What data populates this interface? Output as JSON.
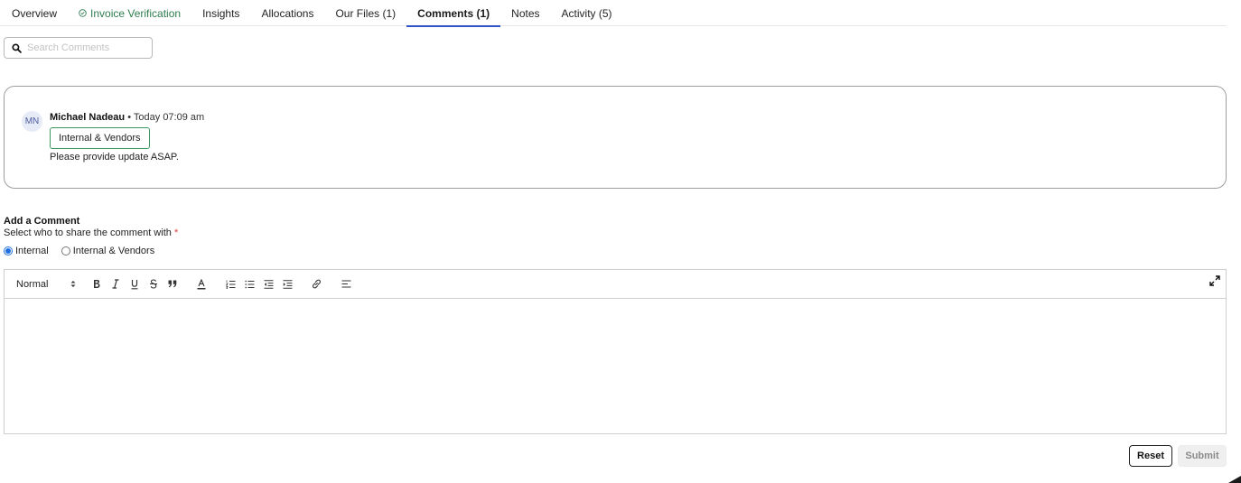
{
  "tabs": [
    {
      "label": "Overview"
    },
    {
      "label": "Invoice Verification",
      "icon": "check-circle-icon"
    },
    {
      "label": "Insights"
    },
    {
      "label": "Allocations"
    },
    {
      "label": "Our Files (1)"
    },
    {
      "label": "Comments (1)",
      "active": true
    },
    {
      "label": "Notes"
    },
    {
      "label": "Activity (5)"
    }
  ],
  "search": {
    "placeholder": "Search Comments",
    "icon": "search-icon"
  },
  "comments": [
    {
      "initials": "MN",
      "author": "Michael Nadeau",
      "separator": " • ",
      "time": "Today 07:09 am",
      "visibility": "Internal & Vendors",
      "text": "Please provide update ASAP."
    }
  ],
  "add_comment": {
    "title": "Add a Comment",
    "share_label": "Select who to share the comment with",
    "required_mark": "*",
    "options": [
      {
        "label": "Internal",
        "selected": true
      },
      {
        "label": "Internal & Vendors",
        "selected": false
      }
    ]
  },
  "editor": {
    "format_value": "Normal",
    "tools": [
      "bold-icon",
      "italic-icon",
      "underline-icon",
      "strikethrough-icon",
      "blockquote-icon",
      "text-color-icon",
      "ordered-list-icon",
      "bullet-list-icon",
      "outdent-icon",
      "indent-icon",
      "link-icon",
      "align-icon",
      "expand-icon"
    ]
  },
  "buttons": {
    "reset": "Reset",
    "submit": "Submit"
  },
  "colors": {
    "accent": "#2f55c8",
    "success": "#2e7d4f",
    "radio": "#1f6fe0",
    "required": "#e0403a"
  }
}
